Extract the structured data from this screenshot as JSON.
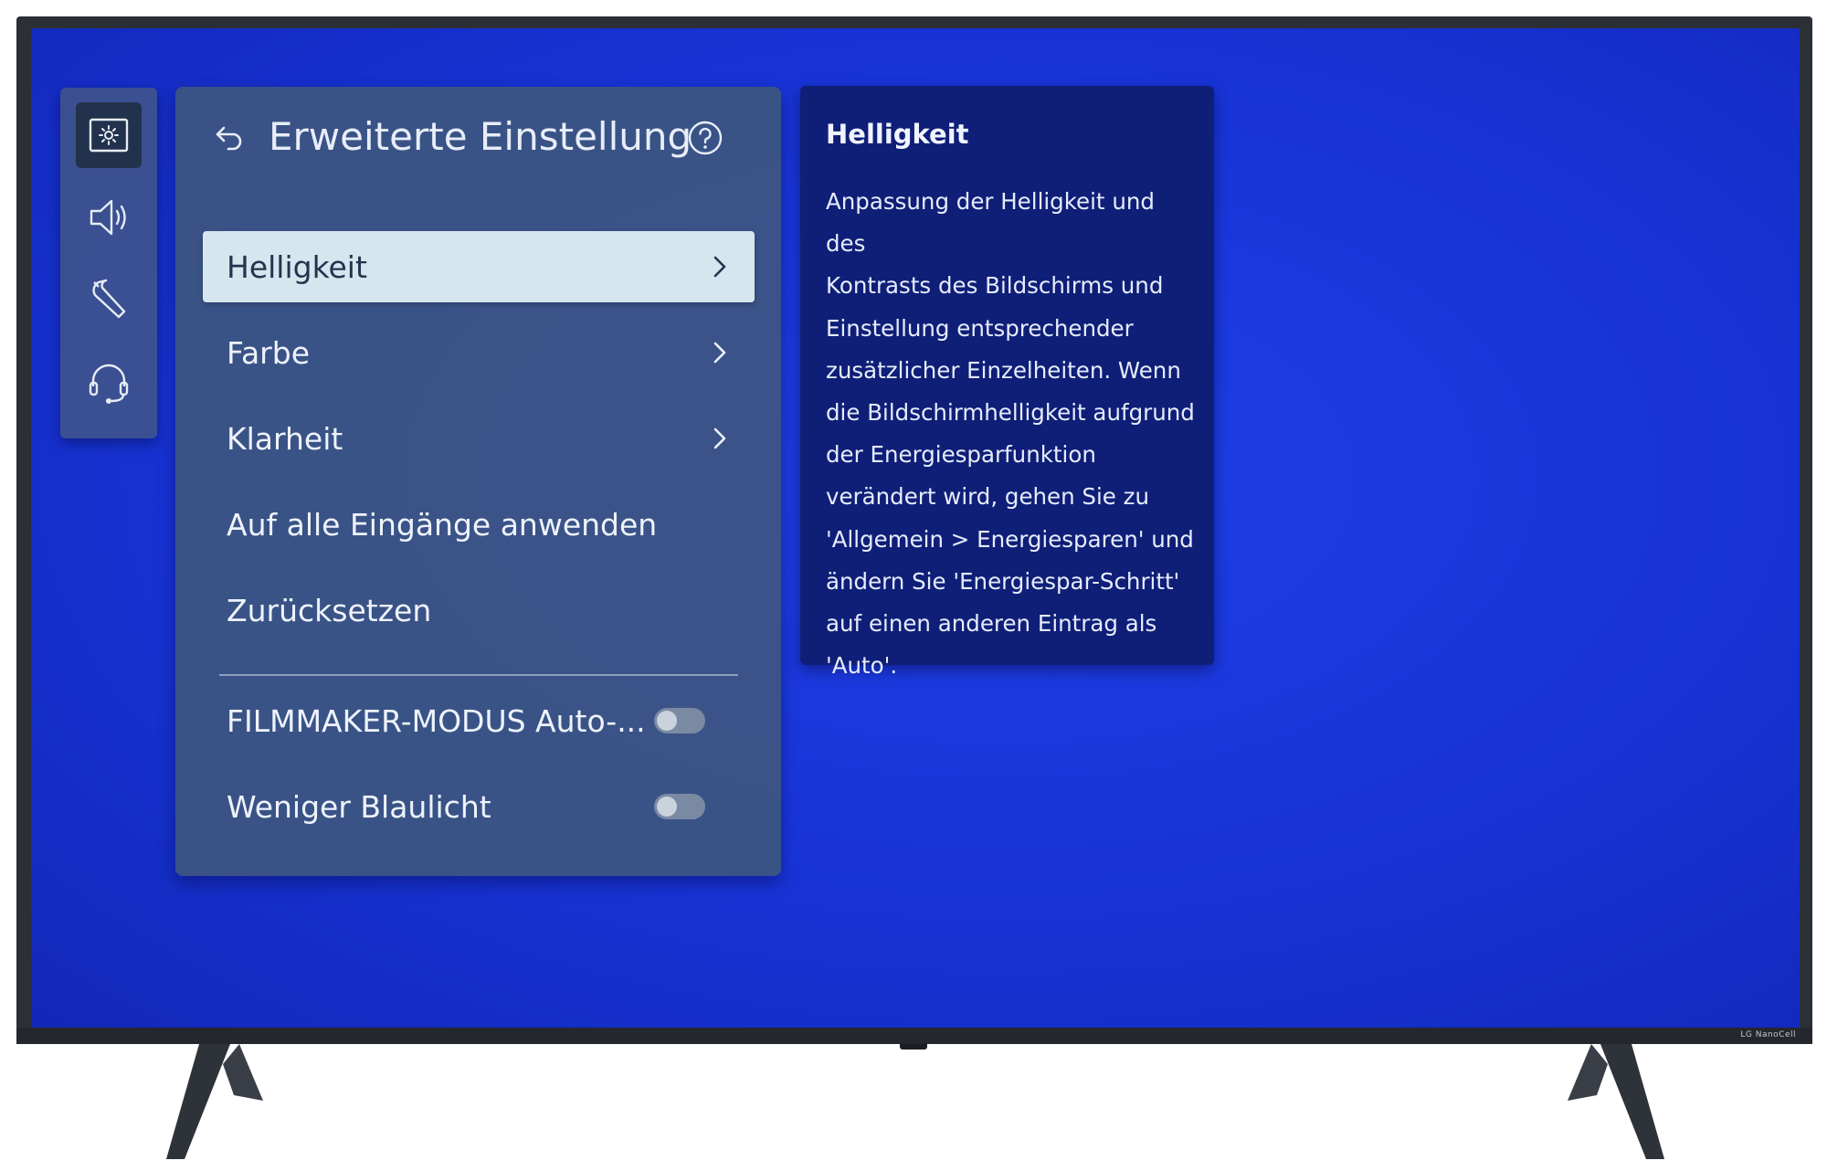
{
  "sidebar": {
    "items": [
      {
        "name": "picture-icon",
        "active": true
      },
      {
        "name": "sound-icon",
        "active": false
      },
      {
        "name": "general-wrench-icon",
        "active": false
      },
      {
        "name": "support-headset-icon",
        "active": false
      }
    ]
  },
  "panel": {
    "title": "Erweiterte Einstellung",
    "back_icon": "back-arrow-icon",
    "help_icon": "help-circle-icon",
    "items": [
      {
        "label": "Helligkeit",
        "chevron": true,
        "selected": true
      },
      {
        "label": "Farbe",
        "chevron": true,
        "selected": false
      },
      {
        "label": "Klarheit",
        "chevron": true,
        "selected": false
      },
      {
        "label": "Auf alle Eingänge anwenden",
        "chevron": false,
        "selected": false
      },
      {
        "label": "Zurücksetzen",
        "chevron": false,
        "selected": false
      }
    ],
    "toggles": [
      {
        "label": "FILMMAKER-MODUS Auto-...",
        "on": false
      },
      {
        "label": "Weniger Blaulicht",
        "on": false
      }
    ]
  },
  "info": {
    "title": "Helligkeit",
    "lines": [
      "Anpassung der Helligkeit und des",
      "Kontrasts des Bildschirms und",
      "Einstellung entsprechender",
      "zusätzlicher Einzelheiten. Wenn",
      "die Bildschirmhelligkeit aufgrund",
      "der Energiesparfunktion",
      "verändert wird, gehen Sie zu",
      "'Allgemein > Energiesparen' und",
      "ändern Sie 'Energiespar-Schritt'",
      "auf einen anderen Eintrag als",
      "'Auto'."
    ]
  },
  "device": {
    "brand_label": "LG NanoCell"
  },
  "colors": {
    "screen_blue": "#1733d6",
    "panel_bg": "#3e5680",
    "selected_bg": "#d6e6ee",
    "info_bg": "#0f1f78"
  }
}
